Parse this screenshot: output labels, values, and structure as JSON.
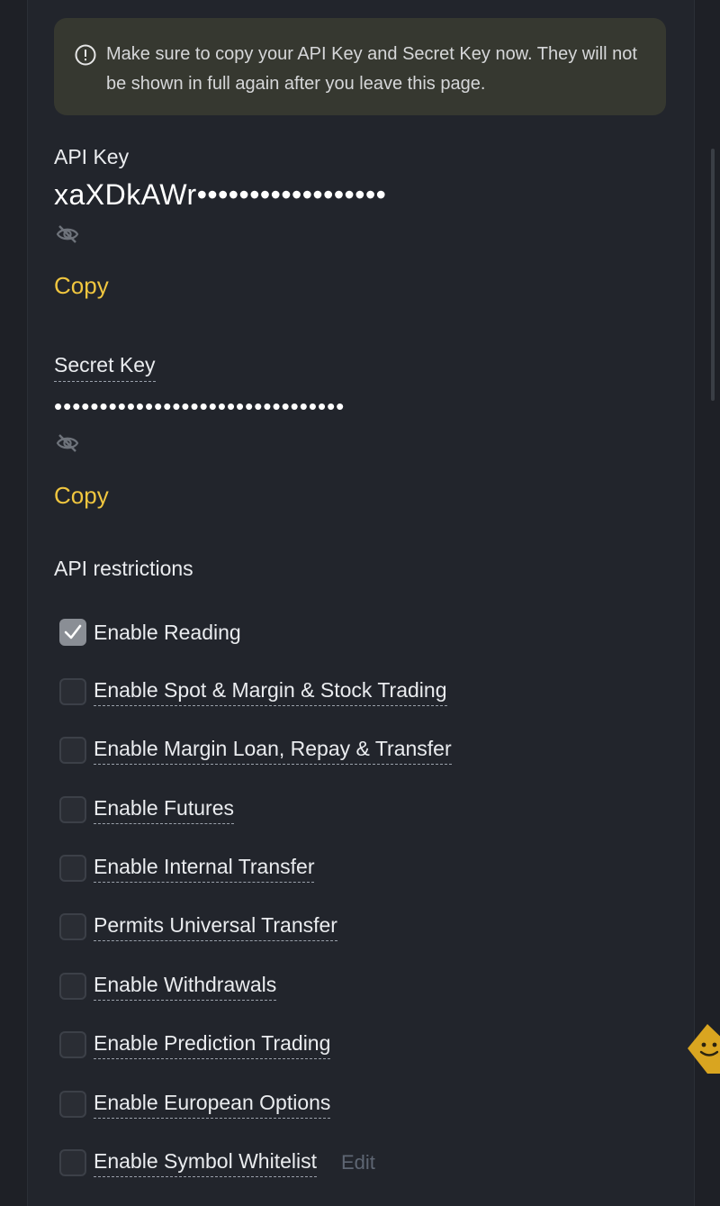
{
  "notice": {
    "icon": "info-circle-icon",
    "text": "Make sure to copy your API Key and Secret Key now. They will not be shown in full again after you leave this page."
  },
  "api_key": {
    "label": "API Key",
    "value": "xaXDkAWr••••••••••••••••••",
    "visibility_icon": "eye-off-icon",
    "copy_label": "Copy"
  },
  "secret_key": {
    "label": "Secret Key",
    "value": "••••••••••••••••••••••••••••••••",
    "visibility_icon": "eye-off-icon",
    "copy_label": "Copy"
  },
  "restrictions": {
    "title": "API restrictions",
    "items": [
      {
        "label": "Enable Reading",
        "checked": true
      },
      {
        "label": "Enable Spot & Margin & Stock Trading",
        "checked": false
      },
      {
        "label": "Enable Margin Loan, Repay & Transfer",
        "checked": false
      },
      {
        "label": "Enable Futures",
        "checked": false
      },
      {
        "label": "Enable Internal Transfer",
        "checked": false
      },
      {
        "label": "Permits Universal Transfer",
        "checked": false
      },
      {
        "label": "Enable Withdrawals",
        "checked": false
      },
      {
        "label": "Enable Prediction Trading",
        "checked": false
      },
      {
        "label": "Enable European Options",
        "checked": false
      },
      {
        "label": "Enable Symbol Whitelist",
        "checked": false
      }
    ],
    "edit_label": "Edit"
  },
  "colors": {
    "accent": "#f0c63f",
    "background": "#22252c",
    "notice_background": "#363830"
  }
}
